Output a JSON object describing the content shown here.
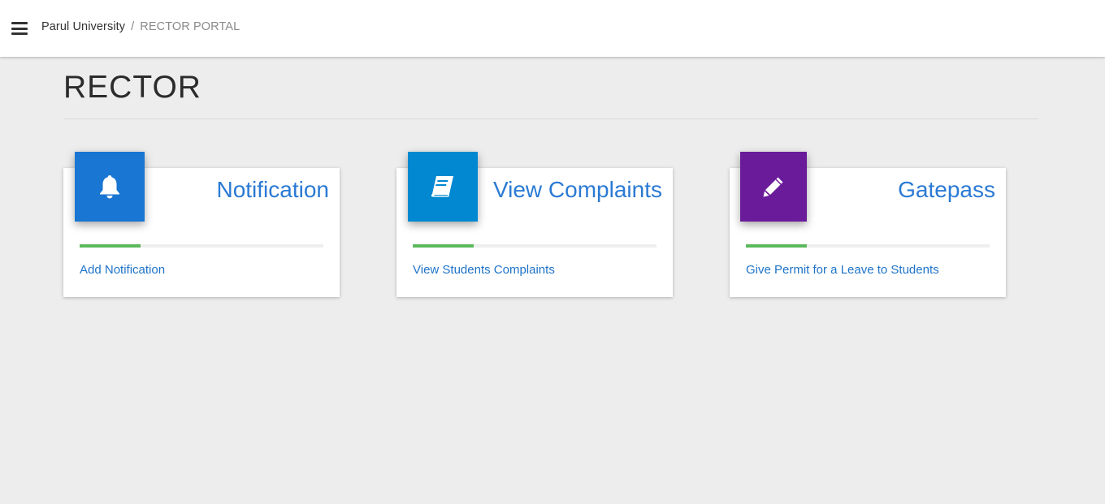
{
  "header": {
    "breadcrumb": {
      "root": "Parul University",
      "separator": "/",
      "current": "RECTOR PORTAL"
    }
  },
  "page": {
    "title": "RECTOR"
  },
  "cards": [
    {
      "title": "Notification",
      "link": "Add Notification",
      "icon": "bell-icon",
      "icon_color": "#1976d2",
      "progress": 0.25
    },
    {
      "title": "View Complaints",
      "link": "View Students Complaints",
      "icon": "book-icon",
      "icon_color": "#0288d1",
      "progress": 0.25
    },
    {
      "title": "Gatepass",
      "link": "Give Permit for a Leave to Students",
      "icon": "pencil-icon",
      "icon_color": "#6a1b9a",
      "progress": 0.25
    }
  ],
  "colors": {
    "accent_text": "#2b7ad4",
    "progress_fill": "#5cb85c",
    "background": "#ededed"
  }
}
